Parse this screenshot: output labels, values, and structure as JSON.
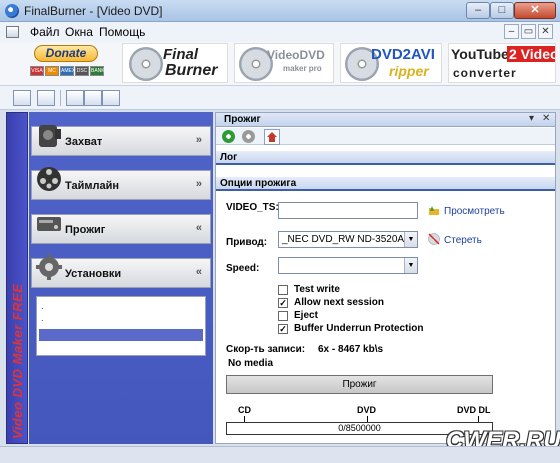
{
  "window": {
    "title": "FinalBurner - [Video DVD]",
    "min": "–",
    "max": "□",
    "close": "✕"
  },
  "menu": {
    "items": [
      "Файл",
      "Окна",
      "Помощь"
    ],
    "mdi": {
      "min": "–",
      "restore": "▭",
      "close": "✕"
    }
  },
  "banner": {
    "donate": "Donate",
    "cards": [
      "VISA",
      "MC",
      "AMEX",
      "DSC",
      "BANK",
      "ECH"
    ],
    "ads": [
      {
        "name": "FinalBurner",
        "line1": "Final",
        "line2": "Burner"
      },
      {
        "name": "VideoDVD maker pro",
        "line1": "VideoDVD",
        "line2": "maker pro"
      },
      {
        "name": "DVD2AVI ripper",
        "line1": "DVD2AVI",
        "line2": "ripper"
      },
      {
        "name": "YouTube 2 Video converter",
        "line1a": "YouTube",
        "line1b": "2 Video",
        "line2": "converter"
      }
    ]
  },
  "sidebar": {
    "vertical_text": "Video DVD Maker FREE",
    "sections": [
      {
        "label": "Захват",
        "chevron": "»"
      },
      {
        "label": "Таймлайн",
        "chevron": "»"
      },
      {
        "label": "Прожиг",
        "chevron": "«"
      },
      {
        "label": "Установки",
        "chevron": "«"
      }
    ],
    "sub_items": [
      ".",
      "."
    ]
  },
  "panel": {
    "title": "Прожиг",
    "pin": "▾",
    "close": "✕",
    "log_label": "Лог",
    "options_label": "Опции прожига",
    "video_ts_label": "VIDEO_TS:",
    "video_ts_value": "",
    "browse_label": "Просмотреть",
    "drive_label": "Привод:",
    "drive_value": "_NEC    DVD_RW ND-3520A",
    "erase_label": "Стереть",
    "speed_label": "Speed:",
    "speed_value": "",
    "options": [
      {
        "label": "Test write",
        "checked": false,
        "mark": ""
      },
      {
        "label": "Allow next session",
        "checked": true,
        "mark": "✓"
      },
      {
        "label": "Eject",
        "checked": false,
        "mark": ""
      },
      {
        "label": "Buffer Underrun Protection",
        "checked": true,
        "mark": "✓"
      }
    ],
    "write_speed_label": "Скор-ть записи:",
    "write_speed_value": "6x - 8467 kb\\s",
    "media_status": "No media",
    "burn_button": "Прожиг",
    "scale_labels": [
      "CD",
      "DVD",
      "DVD DL"
    ],
    "progress_text": "0/8500000"
  },
  "watermark": "CWER.RU"
}
